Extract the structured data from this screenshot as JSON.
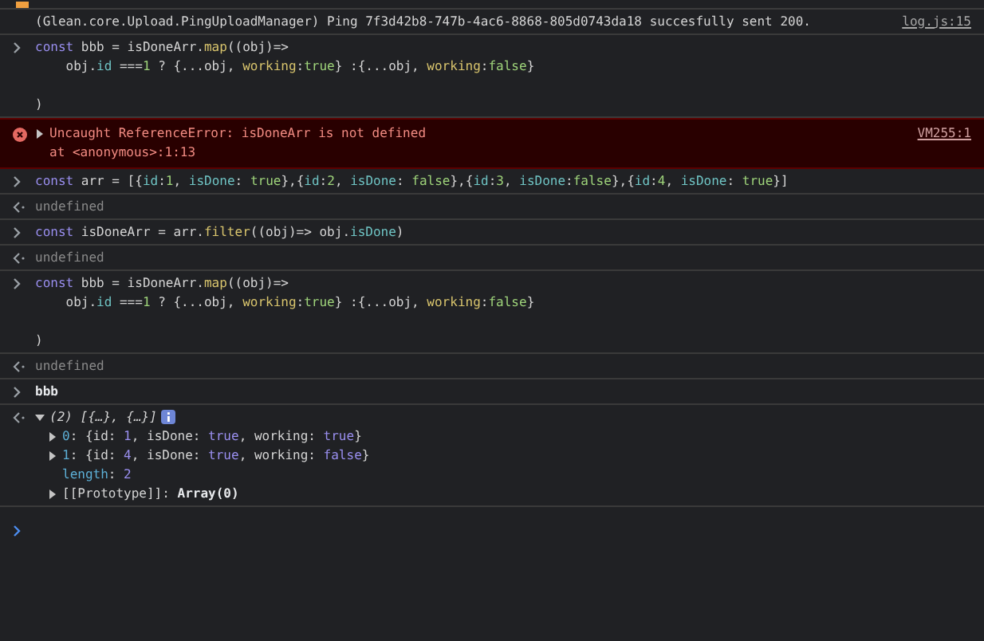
{
  "entries": [
    {
      "kind": "log",
      "text": "(Glean.core.Upload.PingUploadManager) Ping 7f3d42b8-747b-4ac6-8868-805d0743da18 succesfully sent 200.",
      "source": "log.js:15"
    },
    {
      "kind": "input",
      "lines": [
        {
          "segments": [
            {
              "t": "const",
              "kind": "keyword"
            },
            {
              "t": " bbb = isDoneArr.",
              "kind": "plain"
            },
            {
              "t": "map",
              "kind": "method"
            },
            {
              "t": "((obj)=>",
              "kind": "plain"
            }
          ]
        },
        {
          "segments": [
            {
              "t": "    obj.",
              "kind": "plain"
            },
            {
              "t": "id",
              "kind": "property"
            },
            {
              "t": " ===",
              "kind": "plain"
            },
            {
              "t": "1",
              "kind": "number"
            },
            {
              "t": " ? {...obj, ",
              "kind": "plain"
            },
            {
              "t": "working",
              "kind": "key"
            },
            {
              "t": ":",
              "kind": "plain"
            },
            {
              "t": "true",
              "kind": "literal"
            },
            {
              "t": "} :{...obj, ",
              "kind": "plain"
            },
            {
              "t": "working",
              "kind": "key"
            },
            {
              "t": ":",
              "kind": "plain"
            },
            {
              "t": "false",
              "kind": "literal"
            },
            {
              "t": "}",
              "kind": "plain"
            }
          ]
        },
        {
          "segments": [
            {
              "t": "\n)",
              "kind": "plain"
            }
          ]
        }
      ]
    },
    {
      "kind": "error",
      "expanded": false,
      "message": "Uncaught ReferenceError: isDoneArr is not defined",
      "detail": "at <anonymous>:1:13",
      "source": "VM255:1"
    },
    {
      "kind": "input",
      "lines": [
        {
          "segments": [
            {
              "t": "const",
              "kind": "keyword"
            },
            {
              "t": " arr = [{",
              "kind": "plain"
            },
            {
              "t": "id",
              "kind": "property"
            },
            {
              "t": ":",
              "kind": "plain"
            },
            {
              "t": "1",
              "kind": "number"
            },
            {
              "t": ", ",
              "kind": "plain"
            },
            {
              "t": "isDone",
              "kind": "property"
            },
            {
              "t": ": ",
              "kind": "plain"
            },
            {
              "t": "true",
              "kind": "literal"
            },
            {
              "t": "},{",
              "kind": "plain"
            },
            {
              "t": "id",
              "kind": "property"
            },
            {
              "t": ":",
              "kind": "plain"
            },
            {
              "t": "2",
              "kind": "number"
            },
            {
              "t": ", ",
              "kind": "plain"
            },
            {
              "t": "isDone",
              "kind": "property"
            },
            {
              "t": ": ",
              "kind": "plain"
            },
            {
              "t": "false",
              "kind": "literal"
            },
            {
              "t": "},{",
              "kind": "plain"
            },
            {
              "t": "id",
              "kind": "property"
            },
            {
              "t": ":",
              "kind": "plain"
            },
            {
              "t": "3",
              "kind": "number"
            },
            {
              "t": ", ",
              "kind": "plain"
            },
            {
              "t": "isDone",
              "kind": "property"
            },
            {
              "t": ":",
              "kind": "plain"
            },
            {
              "t": "false",
              "kind": "literal"
            },
            {
              "t": "},{",
              "kind": "plain"
            },
            {
              "t": "id",
              "kind": "property"
            },
            {
              "t": ":",
              "kind": "plain"
            },
            {
              "t": "4",
              "kind": "number"
            },
            {
              "t": ", ",
              "kind": "plain"
            },
            {
              "t": "isDone",
              "kind": "property"
            },
            {
              "t": ": ",
              "kind": "plain"
            },
            {
              "t": "true",
              "kind": "literal"
            },
            {
              "t": "}]",
              "kind": "plain"
            }
          ]
        }
      ]
    },
    {
      "kind": "result",
      "text": "undefined"
    },
    {
      "kind": "input",
      "lines": [
        {
          "segments": [
            {
              "t": "const",
              "kind": "keyword"
            },
            {
              "t": " isDoneArr = arr.",
              "kind": "plain"
            },
            {
              "t": "filter",
              "kind": "method"
            },
            {
              "t": "((obj)=> obj.",
              "kind": "plain"
            },
            {
              "t": "isDone",
              "kind": "property"
            },
            {
              "t": ")",
              "kind": "plain"
            }
          ]
        }
      ]
    },
    {
      "kind": "result",
      "text": "undefined"
    },
    {
      "kind": "input",
      "lines": [
        {
          "segments": [
            {
              "t": "const",
              "kind": "keyword"
            },
            {
              "t": " bbb = isDoneArr.",
              "kind": "plain"
            },
            {
              "t": "map",
              "kind": "method"
            },
            {
              "t": "((obj)=>",
              "kind": "plain"
            }
          ]
        },
        {
          "segments": [
            {
              "t": "    obj.",
              "kind": "plain"
            },
            {
              "t": "id",
              "kind": "property"
            },
            {
              "t": " ===",
              "kind": "plain"
            },
            {
              "t": "1",
              "kind": "number"
            },
            {
              "t": " ? {...obj, ",
              "kind": "plain"
            },
            {
              "t": "working",
              "kind": "key"
            },
            {
              "t": ":",
              "kind": "plain"
            },
            {
              "t": "true",
              "kind": "literal"
            },
            {
              "t": "} :{...obj, ",
              "kind": "plain"
            },
            {
              "t": "working",
              "kind": "key"
            },
            {
              "t": ":",
              "kind": "plain"
            },
            {
              "t": "false",
              "kind": "literal"
            },
            {
              "t": "}",
              "kind": "plain"
            }
          ]
        },
        {
          "segments": [
            {
              "t": "\n)",
              "kind": "plain"
            }
          ]
        }
      ]
    },
    {
      "kind": "result",
      "text": "undefined"
    },
    {
      "kind": "input",
      "lines": [
        {
          "segments": [
            {
              "t": "bbb",
              "kind": "bold"
            }
          ]
        }
      ]
    },
    {
      "kind": "object",
      "expanded": true,
      "count": "(2)",
      "preview": "[{…}, {…}]",
      "items": [
        {
          "expandable": true,
          "segments": [
            {
              "t": "0",
              "kind": "index"
            },
            {
              "t": ": {id: ",
              "kind": "plain"
            },
            {
              "t": "1",
              "kind": "value"
            },
            {
              "t": ", isDone: ",
              "kind": "plain"
            },
            {
              "t": "true",
              "kind": "value"
            },
            {
              "t": ", working: ",
              "kind": "plain"
            },
            {
              "t": "true",
              "kind": "value"
            },
            {
              "t": "}",
              "kind": "plain"
            }
          ]
        },
        {
          "expandable": true,
          "segments": [
            {
              "t": "1",
              "kind": "index"
            },
            {
              "t": ": {id: ",
              "kind": "plain"
            },
            {
              "t": "4",
              "kind": "value"
            },
            {
              "t": ", isDone: ",
              "kind": "plain"
            },
            {
              "t": "true",
              "kind": "value"
            },
            {
              "t": ", working: ",
              "kind": "plain"
            },
            {
              "t": "false",
              "kind": "value"
            },
            {
              "t": "}",
              "kind": "plain"
            }
          ]
        },
        {
          "expandable": false,
          "segments": [
            {
              "t": "length",
              "kind": "index"
            },
            {
              "t": ": ",
              "kind": "plain"
            },
            {
              "t": "2",
              "kind": "value"
            }
          ]
        },
        {
          "expandable": true,
          "segments": [
            {
              "t": "[[Prototype]]",
              "kind": "plain"
            },
            {
              "t": ": ",
              "kind": "plain"
            },
            {
              "t": "Array(0)",
              "kind": "bold"
            }
          ]
        }
      ]
    }
  ]
}
